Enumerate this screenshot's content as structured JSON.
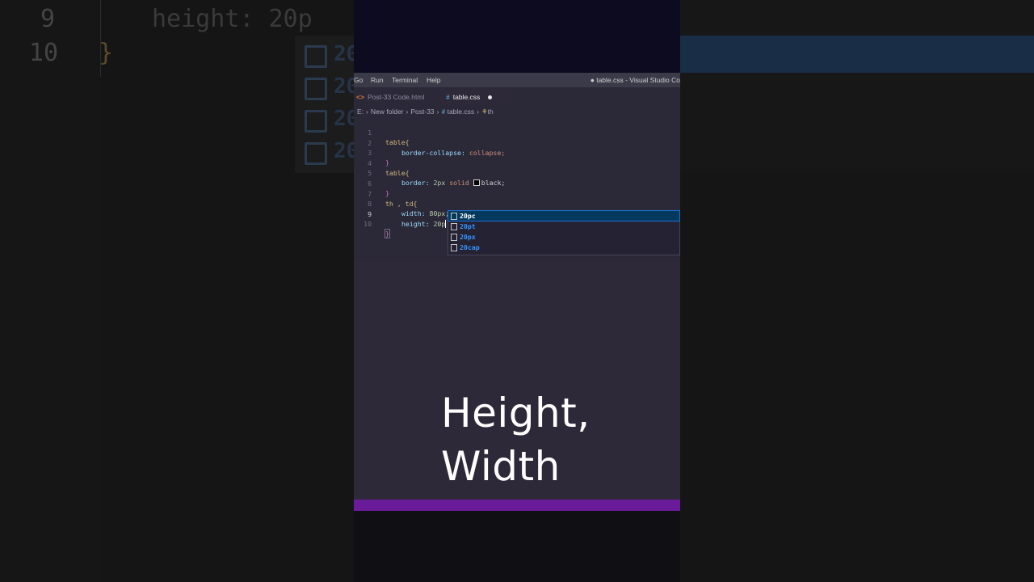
{
  "background": {
    "line_numbers": [
      "9",
      "10"
    ],
    "lines": [
      "height: 20p",
      "}"
    ],
    "suggest_prefix": [
      "20",
      "20",
      "20",
      "20"
    ]
  },
  "menubar": {
    "items": [
      "Go",
      "Run",
      "Terminal",
      "Help"
    ],
    "window_title": "● table.css - Visual Studio Co"
  },
  "tabs": [
    {
      "label": "Post-33 Code.html",
      "icon": "html-file-icon"
    },
    {
      "label": "table.css",
      "icon": "css-file-icon",
      "active": true,
      "unsaved": true
    }
  ],
  "breadcrumb": {
    "drive": "E:",
    "folder": "New folder",
    "subfolder": "Post-33",
    "file": "table.css",
    "symbol": "th"
  },
  "code": {
    "line_numbers": [
      "1",
      "2",
      "3",
      "4",
      "5",
      "6",
      "7",
      "8",
      "9",
      "10"
    ],
    "l1_selector": "table{",
    "l2_prop": "border-collapse:",
    "l2_val": "collapse;",
    "l3": "}",
    "l4_selector": "table{",
    "l5_prop": "border:",
    "l5_num": "2px",
    "l5_val": "solid",
    "l5_color": "black;",
    "l6": "}",
    "l7_selector": "th , td{",
    "l8_prop": "width:",
    "l8_num": "80px;",
    "l9_prop": "height:",
    "l9_num": "20p",
    "l10": "}"
  },
  "suggestions": [
    {
      "label": "20pc",
      "selected": true
    },
    {
      "label": "20pt"
    },
    {
      "label": "20px"
    },
    {
      "label": "20cap"
    }
  ],
  "caption": {
    "line1": "Height,",
    "line2": "Width"
  },
  "colors": {
    "accent_bar": "#6a1b9a",
    "selection": "#04395e",
    "suggestion_text": "#3794ff"
  }
}
